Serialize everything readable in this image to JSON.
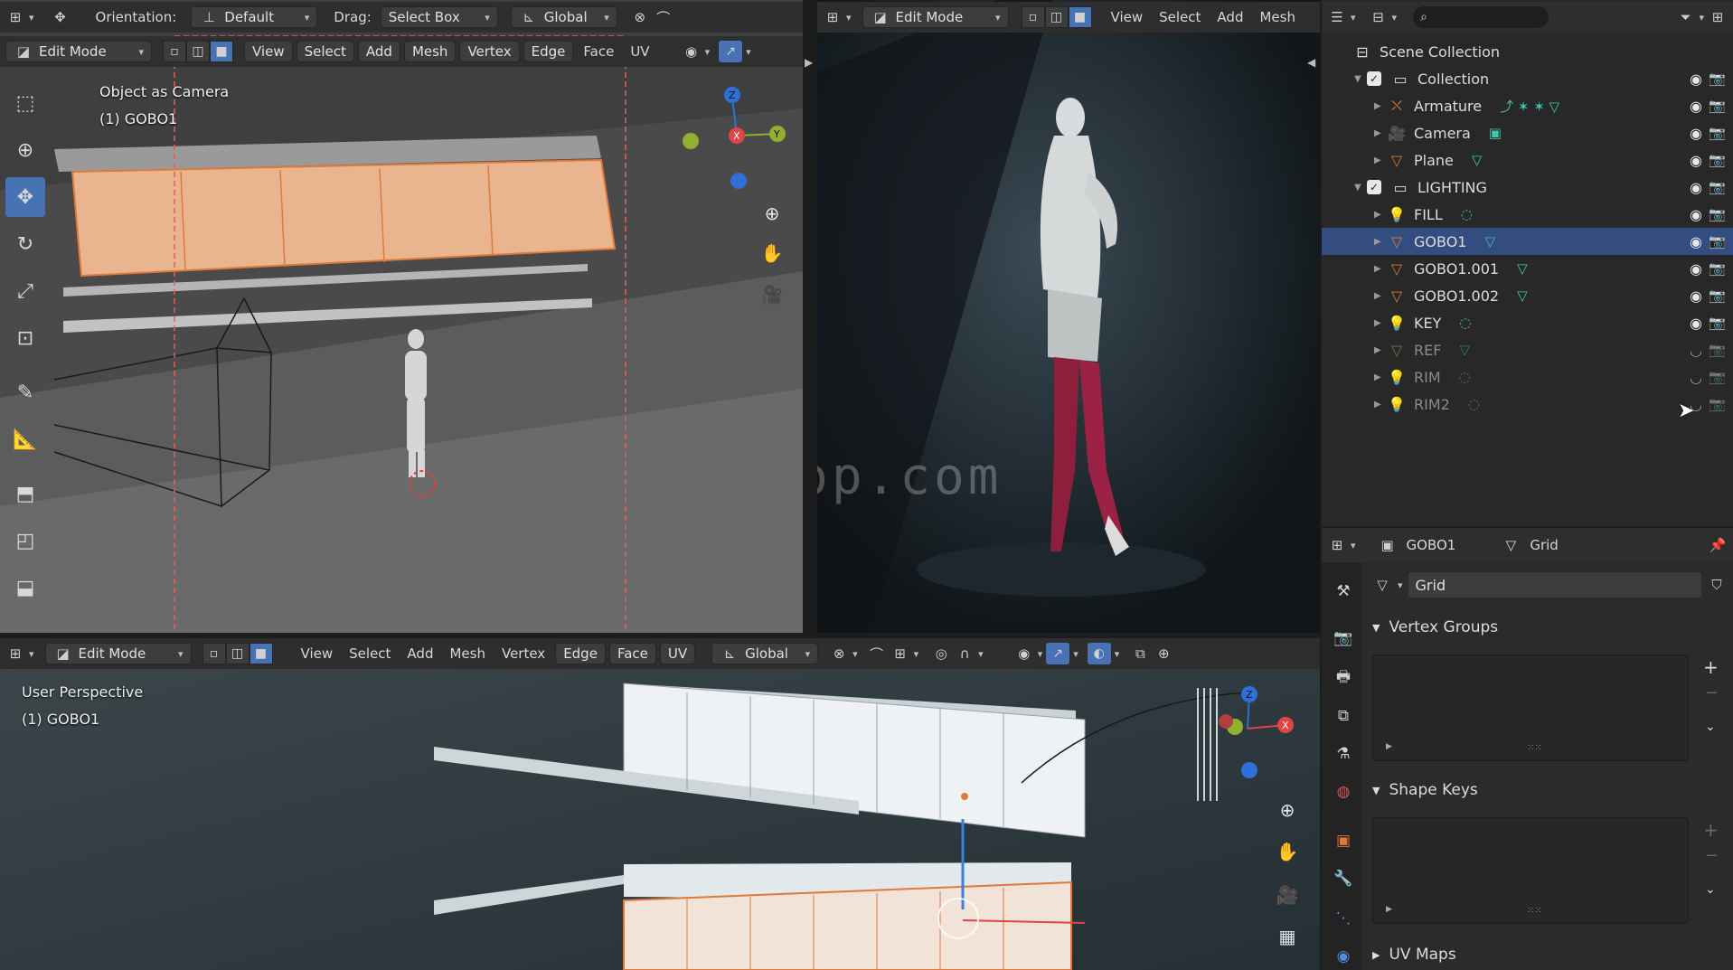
{
  "top_left": {
    "header": {
      "orientation_label": "Orientation:",
      "orientation_value": "Default",
      "drag_label": "Drag:",
      "drag_value": "Select Box",
      "transform_value": "Global"
    },
    "mode": "Edit Mode",
    "menus": [
      "View",
      "Select",
      "Add",
      "Mesh",
      "Vertex",
      "Edge",
      "Face",
      "UV"
    ],
    "overlay_title": "Object as Camera",
    "overlay_object": "(1) GOBO1"
  },
  "render_view": {
    "mode": "Edit Mode",
    "menus": [
      "View",
      "Select",
      "Add",
      "Mesh"
    ],
    "watermark": "cgsop.com"
  },
  "bottom_view": {
    "mode": "Edit Mode",
    "menus": [
      "View",
      "Select",
      "Add",
      "Mesh",
      "Vertex",
      "Edge",
      "Face",
      "UV"
    ],
    "transform_value": "Global",
    "overlay_title": "User Perspective",
    "overlay_object": "(1) GOBO1"
  },
  "outliner": {
    "scene": "Scene Collection",
    "items": [
      {
        "name": "Collection",
        "indent": 1,
        "type": "collection",
        "checked": true
      },
      {
        "name": "Armature",
        "indent": 2,
        "type": "armature"
      },
      {
        "name": "Camera",
        "indent": 2,
        "type": "camera"
      },
      {
        "name": "Plane",
        "indent": 2,
        "type": "mesh"
      },
      {
        "name": "LIGHTING",
        "indent": 1,
        "type": "collection",
        "checked": true
      },
      {
        "name": "FILL",
        "indent": 2,
        "type": "light"
      },
      {
        "name": "GOBO1",
        "indent": 2,
        "type": "mesh",
        "selected": true
      },
      {
        "name": "GOBO1.001",
        "indent": 2,
        "type": "mesh"
      },
      {
        "name": "GOBO1.002",
        "indent": 2,
        "type": "mesh"
      },
      {
        "name": "KEY",
        "indent": 2,
        "type": "light"
      },
      {
        "name": "REF",
        "indent": 2,
        "type": "mesh",
        "hidden": true
      },
      {
        "name": "RIM",
        "indent": 2,
        "type": "light",
        "hidden": true
      },
      {
        "name": "RIM2",
        "indent": 2,
        "type": "light",
        "hidden": true
      }
    ]
  },
  "properties": {
    "object_name": "GOBO1",
    "data_name": "Grid",
    "datablock_field": "Grid",
    "panels": {
      "vertex_groups": "Vertex Groups",
      "shape_keys": "Shape Keys",
      "uv_maps": "UV Maps"
    }
  },
  "colors": {
    "accent": "#4772b3",
    "selection": "#334d80",
    "header": "#2e2e2e",
    "mesh_orange": "#e0793a",
    "data_teal": "#3ec5b0"
  }
}
